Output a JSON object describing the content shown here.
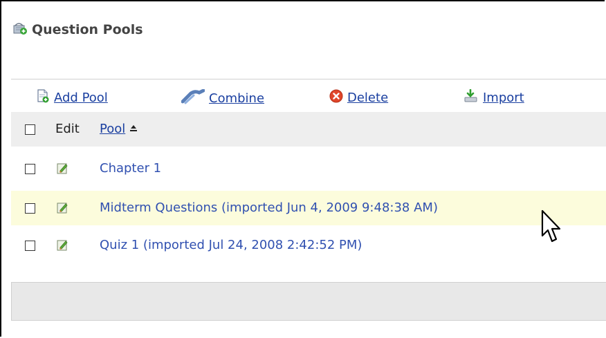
{
  "page": {
    "title": "Question Pools"
  },
  "toolbar": {
    "add_pool": "Add Pool",
    "combine": "Combine",
    "delete": "Delete",
    "import": "Import"
  },
  "table": {
    "header": {
      "edit": "Edit",
      "pool": "Pool"
    },
    "rows": [
      {
        "name": "Chapter 1",
        "highlighted": false
      },
      {
        "name": "Midterm Questions (imported Jun 4, 2009 9:48:38 AM)",
        "highlighted": true
      },
      {
        "name": "Quiz 1 (imported Jul 24, 2008 2:42:52 PM)",
        "highlighted": false
      }
    ]
  },
  "colors": {
    "link": "#1a3fa0",
    "highlight_row": "#fcfcdc",
    "header_bg": "#eeeeee",
    "delete_red": "#e0462a"
  },
  "icons": {
    "title": "question-pool-icon",
    "add_pool": "add-document-icon",
    "combine": "combine-plug-icon",
    "delete": "delete-x-circle-icon",
    "import": "import-arrow-icon",
    "edit": "edit-pencil-icon",
    "sort": "sort-ascending-icon",
    "cursor": "mouse-cursor-icon"
  }
}
